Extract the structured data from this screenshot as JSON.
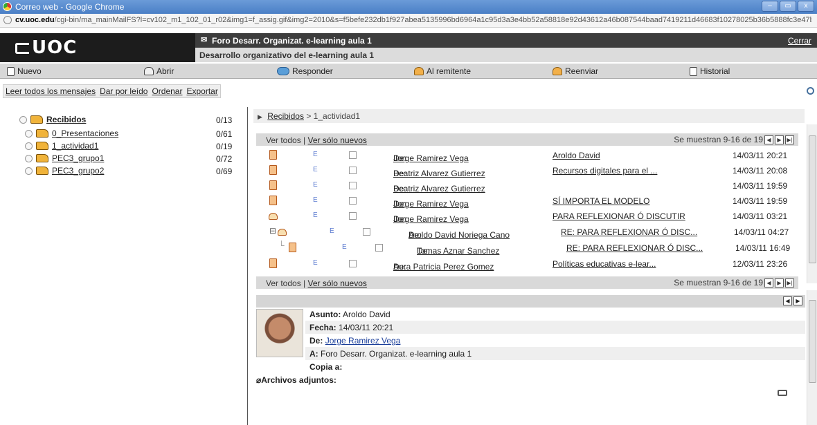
{
  "window": {
    "title": "Correo web - Google Chrome",
    "controls": [
      "–",
      "▭",
      "x"
    ]
  },
  "url": {
    "domain": "cv.uoc.edu",
    "path": "/cgi-bin/ma_mainMailFS?l=cv102_m1_102_01_r02&img1=f_assig.gif&img2=2010&s=f5befe232db1f927abea5135996bd6964a1c95d3a3e4bb52a58818e92d43612a46b087544baad7419211d46683f10278025b36b5888fc3e47b30f9cca9b40285"
  },
  "header": {
    "logo": "UOC",
    "forum_title": "Foro Desarr. Organizat. e-learning aula 1",
    "subtitle": "Desarrollo organizativo del e-learning aula 1",
    "close": "Cerrar"
  },
  "toolbar": {
    "new": "Nuevo",
    "open": "Abrir",
    "reply": "Responder",
    "to_sender": "Al remitente",
    "forward": "Reenviar",
    "history": "Historial"
  },
  "actions": {
    "read_all": "Leer todos los mensajes",
    "mark_read": "Dar por leído",
    "sort": "Ordenar",
    "export": "Exportar"
  },
  "folders": [
    {
      "name": "Recibidos",
      "count": "0/13"
    },
    {
      "name": "0_Presentaciones",
      "count": "0/61"
    },
    {
      "name": "1_actividad1",
      "count": "0/19"
    },
    {
      "name": "PEC3_grupo1",
      "count": "0/72"
    },
    {
      "name": "PEC3_grupo2",
      "count": "0/69"
    }
  ],
  "breadcrumb": {
    "root": "Recibidos",
    "sep": ">",
    "current": "1_actividad1"
  },
  "list": {
    "view_all": "Ver todos",
    "pipe": "|",
    "view_new": "Ver sólo nuevos",
    "showing": "Se muestran 9-16 de 19",
    "from_label": "De:",
    "messages": [
      {
        "flag": "E",
        "from": "Jorge Ramirez Vega",
        "subject": "Aroldo David",
        "date": "14/03/11 20:21"
      },
      {
        "flag": "E",
        "from": "Beatriz Alvarez Gutierrez",
        "subject": "Recursos digitales para el ...",
        "date": "14/03/11 20:08"
      },
      {
        "flag": "E",
        "from": "Beatriz Alvarez Gutierrez",
        "subject": "",
        "date": "14/03/11 19:59"
      },
      {
        "flag": "E",
        "from": "Jorge Ramirez Vega",
        "subject": "SÍ IMPORTA EL MODELO",
        "date": "14/03/11 19:59"
      },
      {
        "flag": "E",
        "from": "Jorge Ramirez Vega",
        "subject": "PARA REFLEXIONAR Ó DISCUTIR",
        "date": "14/03/11 03:21"
      },
      {
        "flag": "E",
        "from": "Aroldo David Noriega Cano",
        "subject": "RE: PARA REFLEXIONAR Ó DISC...",
        "date": "14/03/11 04:27"
      },
      {
        "flag": "E",
        "from": "Tomas Aznar Sanchez",
        "subject": "RE: PARA REFLEXIONAR Ó DISC...",
        "date": "14/03/11 16:49"
      },
      {
        "flag": "E",
        "from": "Aura Patricia Perez Gomez",
        "subject": "Políticas educativas e-lear...",
        "date": "12/03/11 23:26"
      }
    ]
  },
  "preview": {
    "subject_label": "Asunto:",
    "subject": "Aroldo David",
    "date_label": "Fecha:",
    "date": "14/03/11 20:21",
    "from_label": "De:",
    "from": "Jorge Ramirez Vega",
    "to_label": "A:",
    "to": "Foro Desarr. Organizat. e-learning aula 1",
    "cc_label": "Copia a:",
    "attachments_label": "Archivos adjuntos:"
  }
}
